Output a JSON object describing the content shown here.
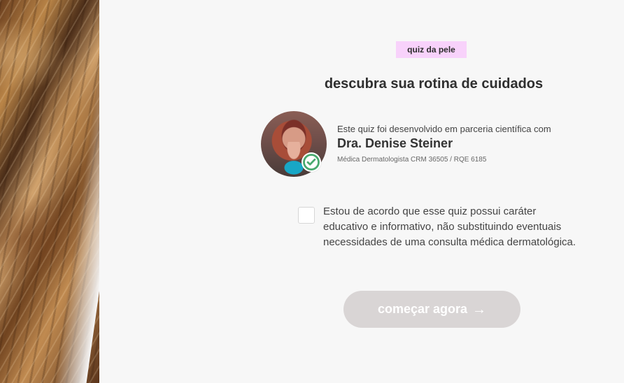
{
  "quiz": {
    "badge": "quiz da pele",
    "title": "descubra sua rotina de cuidados"
  },
  "doctor": {
    "intro": "Este quiz foi desenvolvido em parceria científica com",
    "name": "Dra. Denise Steiner",
    "credentials": "Médica Dermatologista CRM 36505 / RQE 6185",
    "verified_icon": "check-circle-icon"
  },
  "agreement": {
    "checked": false,
    "text": "Estou de acordo que esse quiz possui caráter educativo e informativo, não substituindo eventuais necessidades de uma consulta médica dermatológica."
  },
  "actions": {
    "start_label": "começar agora",
    "arrow_glyph": "→"
  },
  "colors": {
    "badge_background": "#f8d2fb",
    "button_background": "#d9d5d5",
    "verified_green": "#48a96e",
    "page_background": "#f7f7f7"
  }
}
